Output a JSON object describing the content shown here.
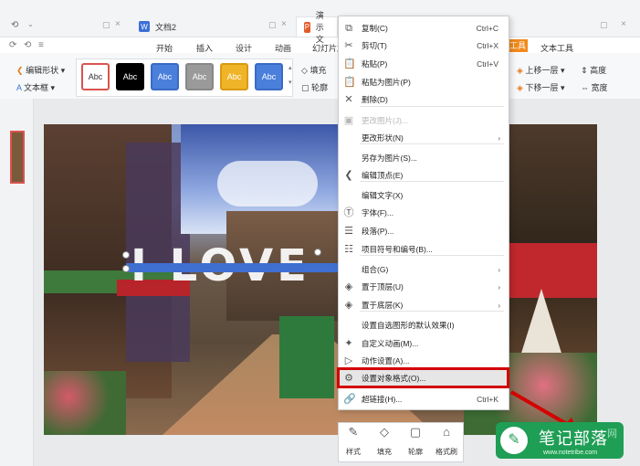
{
  "tabs": {
    "doc2_label": "文档2",
    "ppt_label": "演示文"
  },
  "menu_bar": [
    "开始",
    "插入",
    "设计",
    "动画",
    "幻灯片放"
  ],
  "ribbon": {
    "edit_shape": "编辑形状",
    "text_box": "文本框",
    "fill": "填充",
    "outline": "轮廓",
    "drawing_tools_tab": "工具",
    "text_tools_tab": "文本工具",
    "bring_forward": "上移一层",
    "send_backward": "下移一层",
    "height": "高度",
    "width": "宽度",
    "style_presets": [
      {
        "label": "Abc",
        "bg": "#ffffff",
        "fg": "#333333",
        "border": "#d9534f"
      },
      {
        "label": "Abc",
        "bg": "#000000",
        "fg": "#ffffff",
        "border": "#000000"
      },
      {
        "label": "Abc",
        "bg": "#4a7fdc",
        "fg": "#ffffff",
        "border": "#3a6bc4"
      },
      {
        "label": "Abc",
        "bg": "#9a9a9a",
        "fg": "#ffffff",
        "border": "#888888"
      },
      {
        "label": "Abc",
        "bg": "#f0b429",
        "fg": "#ffffff",
        "border": "#d99a12"
      },
      {
        "label": "Abc",
        "bg": "#4a7fdc",
        "fg": "#ffffff",
        "border": "#3a6bc4"
      }
    ]
  },
  "slide": {
    "text": "I LOVE"
  },
  "context_menu": {
    "items": [
      {
        "label": "复制(C)",
        "shortcut": "Ctrl+C",
        "icon": "copy-icon",
        "glyph": "⧉"
      },
      {
        "label": "剪切(T)",
        "shortcut": "Ctrl+X",
        "icon": "scissors-icon",
        "glyph": "✂"
      },
      {
        "label": "粘贴(P)",
        "shortcut": "Ctrl+V",
        "icon": "paste-icon",
        "glyph": "📋"
      },
      {
        "label": "粘贴为图片(P)",
        "shortcut": "",
        "icon": "paste-image-icon",
        "glyph": "📋"
      },
      {
        "label": "删除(D)",
        "shortcut": "",
        "icon": "delete-icon",
        "glyph": "✕"
      },
      {
        "label": "更改图片(J)...",
        "shortcut": "",
        "icon": "change-image-icon",
        "glyph": "▣",
        "disabled": true
      },
      {
        "label": "更改形状(N)",
        "shortcut": "",
        "icon": "",
        "glyph": "",
        "submenu": true
      },
      {
        "label": "另存为图片(S)...",
        "shortcut": "",
        "icon": "",
        "glyph": ""
      },
      {
        "label": "编辑顶点(E)",
        "shortcut": "",
        "icon": "edit-points-icon",
        "glyph": "❮"
      },
      {
        "label": "编辑文字(X)",
        "shortcut": "",
        "icon": "",
        "glyph": ""
      },
      {
        "label": "字体(F)...",
        "shortcut": "",
        "icon": "font-icon",
        "glyph": "Ⓣ"
      },
      {
        "label": "段落(P)...",
        "shortcut": "",
        "icon": "paragraph-icon",
        "glyph": "☰"
      },
      {
        "label": "项目符号和编号(B)...",
        "shortcut": "",
        "icon": "bullets-icon",
        "glyph": "☷"
      },
      {
        "label": "组合(G)",
        "shortcut": "",
        "icon": "",
        "glyph": "",
        "submenu": true
      },
      {
        "label": "置于顶层(U)",
        "shortcut": "",
        "icon": "bring-to-front-icon",
        "glyph": "◈",
        "submenu": true
      },
      {
        "label": "置于底层(K)",
        "shortcut": "",
        "icon": "send-to-back-icon",
        "glyph": "◈",
        "submenu": true
      },
      {
        "label": "设置自选图形的默认效果(I)",
        "shortcut": "",
        "icon": "",
        "glyph": ""
      },
      {
        "label": "自定义动画(M)...",
        "shortcut": "",
        "icon": "custom-animation-icon",
        "glyph": "✦"
      },
      {
        "label": "动作设置(A)...",
        "shortcut": "",
        "icon": "action-settings-icon",
        "glyph": "▷"
      },
      {
        "label": "设置对象格式(O)...",
        "shortcut": "",
        "icon": "format-object-icon",
        "glyph": "⚙",
        "highlighted": true
      },
      {
        "label": "超链接(H)...",
        "shortcut": "Ctrl+K",
        "icon": "hyperlink-icon",
        "glyph": "🔗"
      }
    ]
  },
  "mini_toolbar": [
    {
      "label": "样式",
      "icon": "brush-icon",
      "glyph": "✎"
    },
    {
      "label": "填充",
      "icon": "fill-bucket-icon",
      "glyph": "◇"
    },
    {
      "label": "轮廓",
      "icon": "outline-icon",
      "glyph": "▢"
    },
    {
      "label": "格式刷",
      "icon": "format-painter-icon",
      "glyph": "⌂"
    }
  ],
  "watermark": {
    "title": "笔记部落",
    "url": "www.notetribe.com",
    "site": "网"
  }
}
